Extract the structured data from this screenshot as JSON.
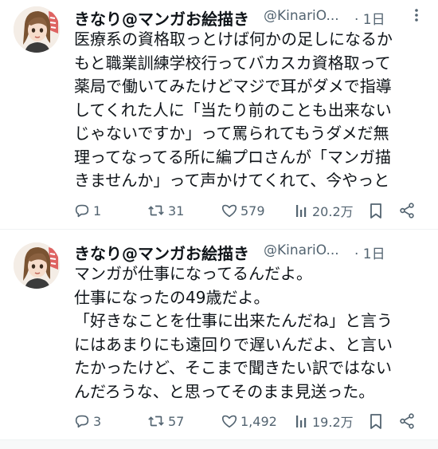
{
  "colors": {
    "text": "#0f1419",
    "secondary": "#536471",
    "divider": "#eff3f4",
    "background": "#ffffff"
  },
  "tweets": [
    {
      "author_name": "きなり@マンガお絵描き",
      "handle": "@KinariO...",
      "time": "· 1日",
      "lines": [
        "医療系の資格取っとけば何かの足しになるか",
        "もと職業訓練学校行ってバカスカ資格取って",
        "薬局で働いてみたけどマジで耳がダメで指導",
        "してくれた人に「当たり前のことも出来ない",
        "じゃないですか」って罵られてもうダメだ無",
        "理ってなってる所に編プロさんが「マンガ描",
        "きませんか」って声かけてくれて、今やっと"
      ],
      "replies": "1",
      "retweets": "31",
      "likes": "579",
      "views": "20.2万",
      "icons": [
        "more-icon",
        "reply-icon",
        "retweet-icon",
        "like-icon",
        "views-icon",
        "bookmark-icon",
        "share-icon"
      ]
    },
    {
      "author_name": "きなり@マンガお絵描き",
      "handle": "@KinariO...",
      "time": "· 1日",
      "lines": [
        "マンガが仕事になってるんだよ。",
        "仕事になったの49歳だよ。",
        "「好きなことを仕事に出来たんだね」と言う",
        "にはあまりにも遠回りで遅いんだよ、と言い",
        "たかったけど、そこまで聞きたい訳ではない",
        "んだろうな、と思ってそのまま見送った。"
      ],
      "replies": "3",
      "retweets": "57",
      "likes": "1,492",
      "views": "19.2万",
      "icons": [
        "more-icon",
        "reply-icon",
        "retweet-icon",
        "like-icon",
        "views-icon",
        "bookmark-icon",
        "share-icon"
      ]
    }
  ]
}
